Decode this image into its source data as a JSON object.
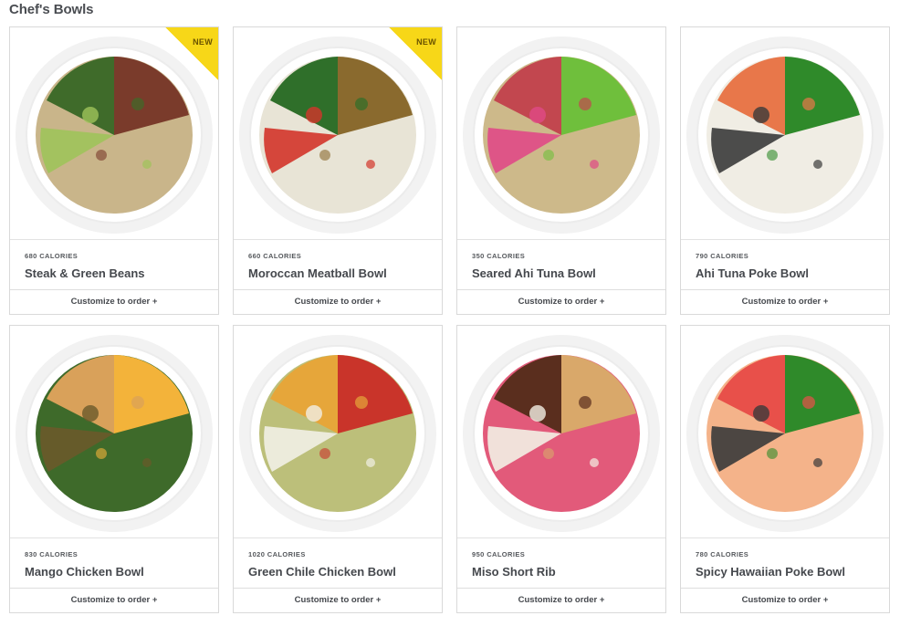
{
  "section": {
    "title": "Chef's Bowls"
  },
  "bowls": [
    {
      "badge": "NEW",
      "calories": "680 CALORIES",
      "name": "Steak & Green Beans",
      "cta": "Customize to order +",
      "palette": [
        "#3f6b2a",
        "#7a3b2b",
        "#c9b58a",
        "#9fc35a"
      ]
    },
    {
      "badge": "NEW",
      "calories": "660 CALORIES",
      "name": "Moroccan Meatball Bowl",
      "cta": "Customize to order +",
      "palette": [
        "#2f6f2a",
        "#8a6a2e",
        "#e8e4d6",
        "#d3342a"
      ]
    },
    {
      "badge": "",
      "calories": "350 CALORIES",
      "name": "Seared Ahi Tuna Bowl",
      "cta": "Customize to order +",
      "palette": [
        "#c2474f",
        "#6fbf3c",
        "#cdb98a",
        "#e04a86"
      ]
    },
    {
      "badge": "",
      "calories": "790 CALORIES",
      "name": "Ahi Tuna Poke Bowl",
      "cta": "Customize to order +",
      "palette": [
        "#e8774a",
        "#2f8a2a",
        "#f0ede4",
        "#3a3a3a"
      ]
    },
    {
      "badge": "",
      "calories": "830 CALORIES",
      "name": "Mango Chicken Bowl",
      "cta": "Customize to order +",
      "palette": [
        "#d9a15a",
        "#f3b33a",
        "#3e6a2a",
        "#6a5a2a"
      ]
    },
    {
      "badge": "",
      "calories": "1020 CALORIES",
      "name": "Green Chile Chicken Bowl",
      "cta": "Customize to order +",
      "palette": [
        "#e6a63a",
        "#c9342a",
        "#bcbf7a",
        "#f1efe6"
      ]
    },
    {
      "badge": "",
      "calories": "950 CALORIES",
      "name": "Miso Short Rib",
      "cta": "Customize to order +",
      "palette": [
        "#5a2e1e",
        "#d9a86a",
        "#e25a7a",
        "#f3efe4"
      ]
    },
    {
      "badge": "",
      "calories": "780 CALORIES",
      "name": "Spicy Hawaiian Poke Bowl",
      "cta": "Customize to order +",
      "palette": [
        "#e8504a",
        "#2f8a2a",
        "#f4b38a",
        "#3a3a3a"
      ]
    }
  ]
}
